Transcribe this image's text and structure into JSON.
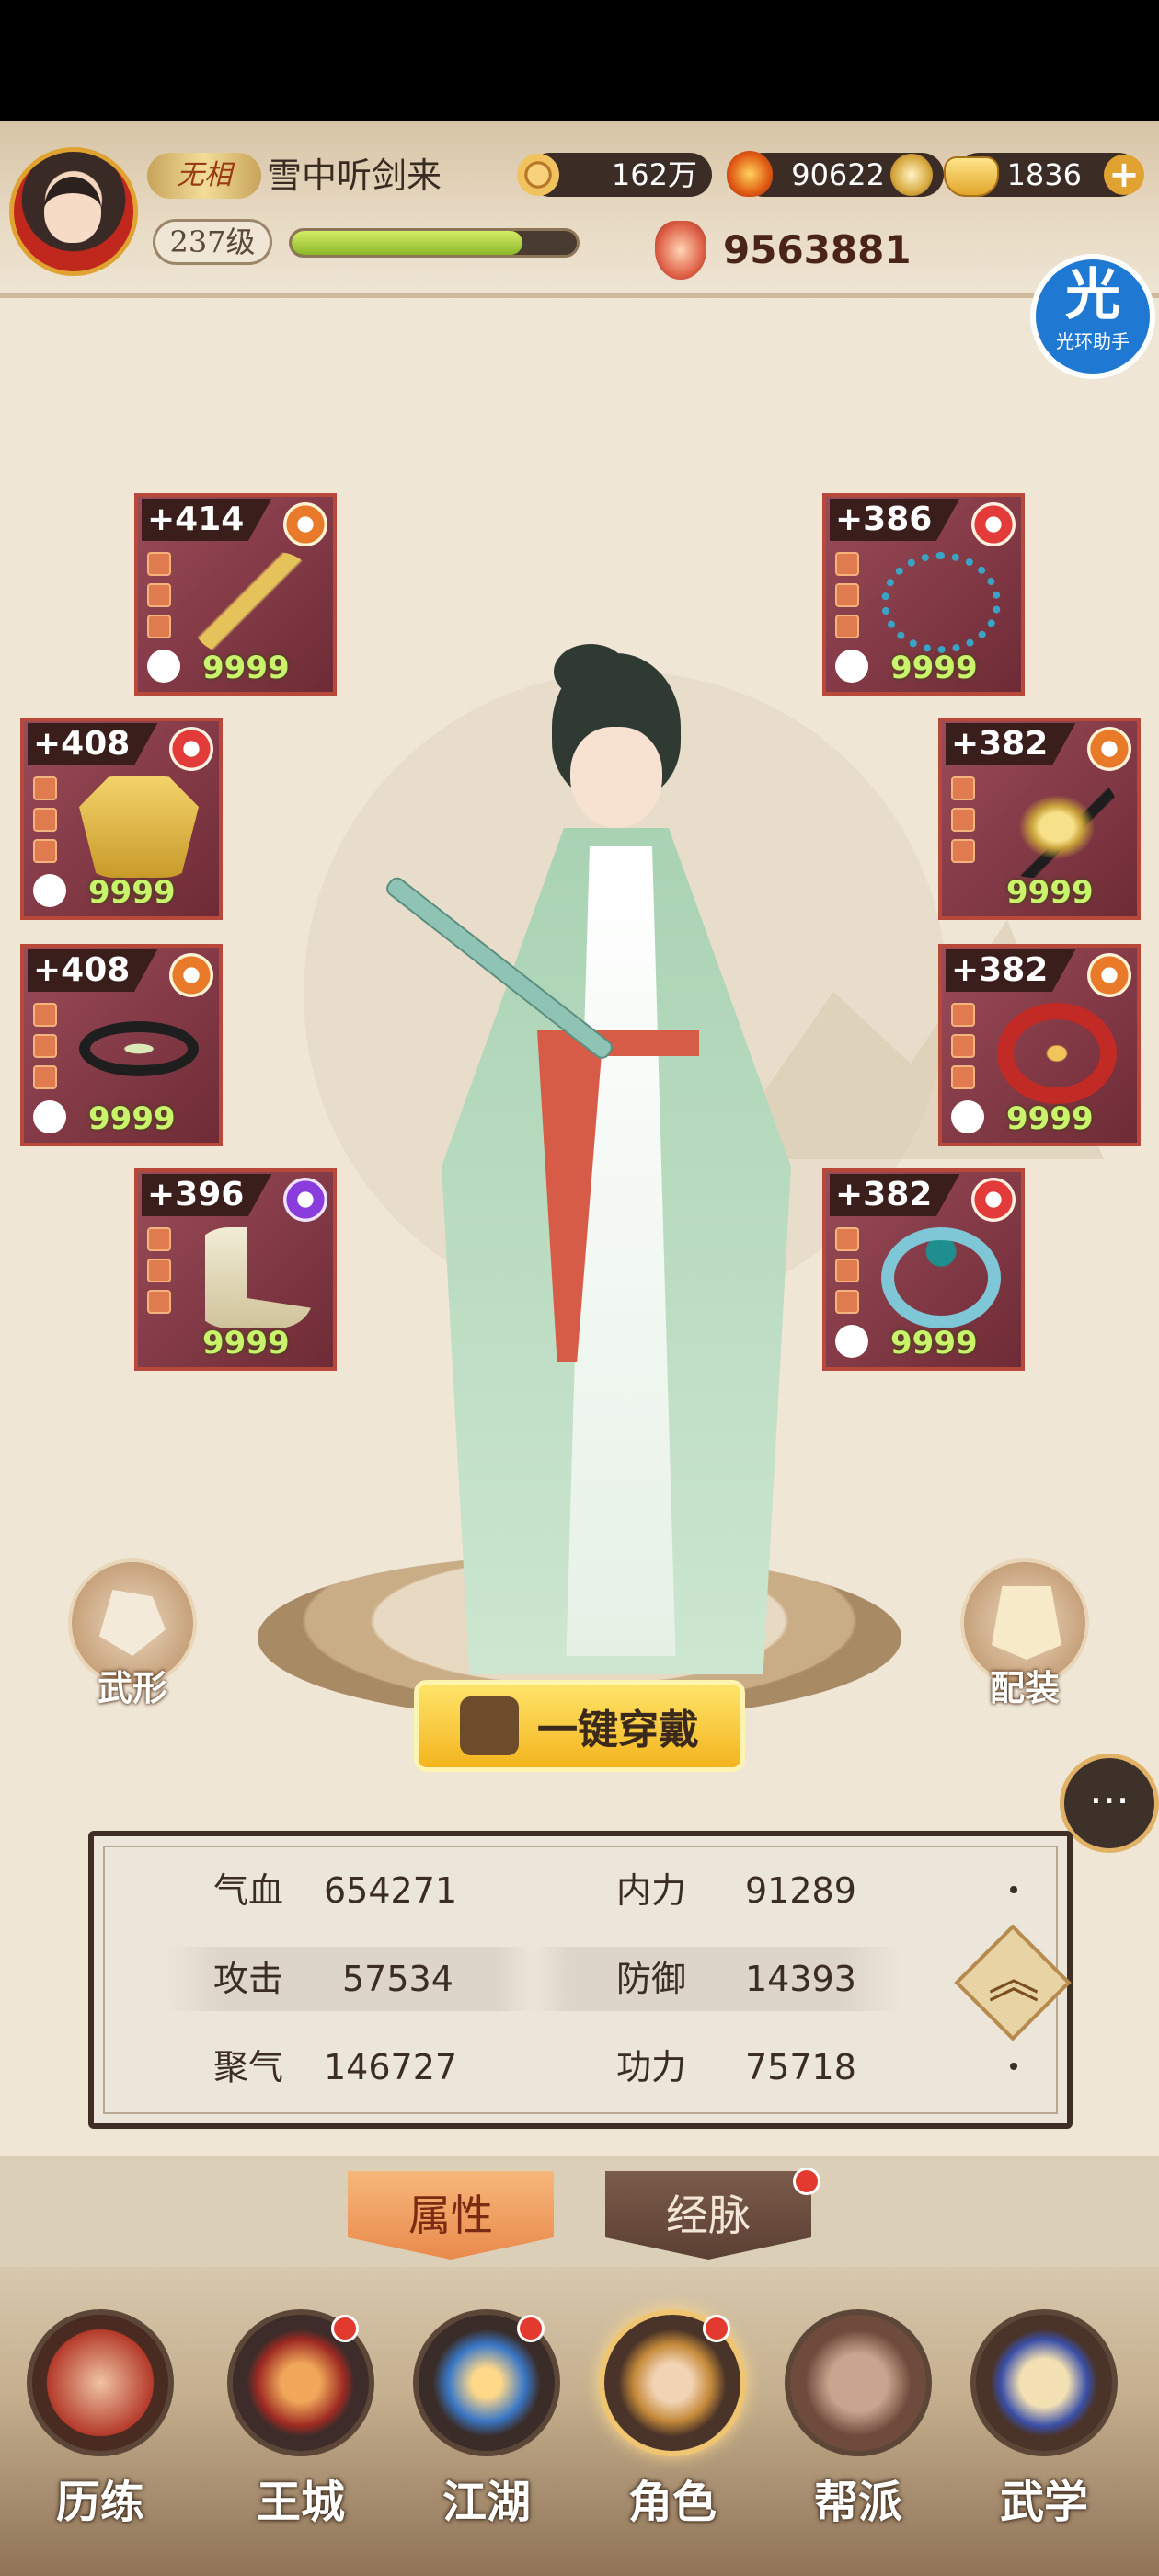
{
  "header": {
    "rank_title": "无相",
    "player_name": "雪中听剑来",
    "level": "237级",
    "xp_fraction": 0.81,
    "power": "9563881"
  },
  "currencies": {
    "copper": "162万",
    "flame": "90622",
    "gold": "1836"
  },
  "helper": {
    "char": "光",
    "label": "光环助手"
  },
  "equipment": {
    "left": [
      {
        "level": "+414",
        "count": "9999",
        "badge": "orange",
        "item": "sword"
      },
      {
        "level": "+408",
        "count": "9999",
        "badge": "red",
        "item": "robe"
      },
      {
        "level": "+408",
        "count": "9999",
        "badge": "orange",
        "item": "belt"
      },
      {
        "level": "+396",
        "count": "9999",
        "badge": "purple",
        "item": "boots"
      }
    ],
    "right": [
      {
        "level": "+386",
        "count": "9999",
        "badge": "red",
        "item": "necklace"
      },
      {
        "level": "+382",
        "count": "9999",
        "badge": "orange",
        "item": "hairpin"
      },
      {
        "level": "+382",
        "count": "9999",
        "badge": "orange",
        "item": "bracer"
      },
      {
        "level": "+382",
        "count": "9999",
        "badge": "red",
        "item": "ring"
      }
    ]
  },
  "actions": {
    "appearance": "武形",
    "outfit": "配装",
    "equip_all": "一键穿戴"
  },
  "stats": [
    {
      "label": "气血",
      "value": "654271"
    },
    {
      "label": "内力",
      "value": "91289"
    },
    {
      "label": "攻击",
      "value": "57534"
    },
    {
      "label": "防御",
      "value": "14393"
    },
    {
      "label": "聚气",
      "value": "146727"
    },
    {
      "label": "功力",
      "value": "75718"
    }
  ],
  "tabs": [
    {
      "label": "属性",
      "active": true
    },
    {
      "label": "经脉",
      "active": false
    }
  ],
  "nav": [
    {
      "label": "历练"
    },
    {
      "label": "王城"
    },
    {
      "label": "江湖"
    },
    {
      "label": "角色"
    },
    {
      "label": "帮派"
    },
    {
      "label": "武学"
    }
  ],
  "colors": {
    "slot_bg": "#8a3f4c",
    "slot_border": "#b8483a",
    "count_green": "#c9f36b",
    "tab_active": "#e98a4c",
    "badge_red": "#e23a2f"
  }
}
